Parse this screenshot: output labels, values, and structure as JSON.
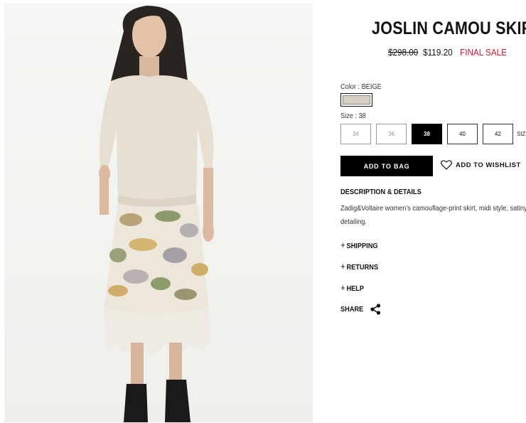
{
  "product": {
    "title": "JOSLIN CAMOU SKIRT",
    "old_price": "$298.00",
    "price": "$119.20",
    "sale_label": "FINAL SALE",
    "image_icon": "product-photo"
  },
  "color": {
    "label": "Color : BEIGE",
    "swatch_color": "#d7d0c2"
  },
  "size": {
    "label": "Size : 38",
    "options": [
      "34",
      "36",
      "38",
      "40",
      "42"
    ],
    "selected": "38",
    "unavailable": [
      "34",
      "36"
    ],
    "guide_label": "SIZ"
  },
  "actions": {
    "add_to_bag": "ADD TO BAG",
    "add_to_wishlist": "ADD TO WISHLIST"
  },
  "description": {
    "heading": "DESCRIPTION & DETAILS",
    "text": "Zadig&Voltaire women's camouflage-print skirt, midi style, satiny detailing."
  },
  "accordion": {
    "shipping": "SHIPPING",
    "returns": "RETURNS",
    "help": "HELP",
    "plus": "+"
  },
  "share": {
    "label": "SHARE"
  },
  "colors": {
    "sale_red": "#c41f3a",
    "button_black": "#000000"
  }
}
